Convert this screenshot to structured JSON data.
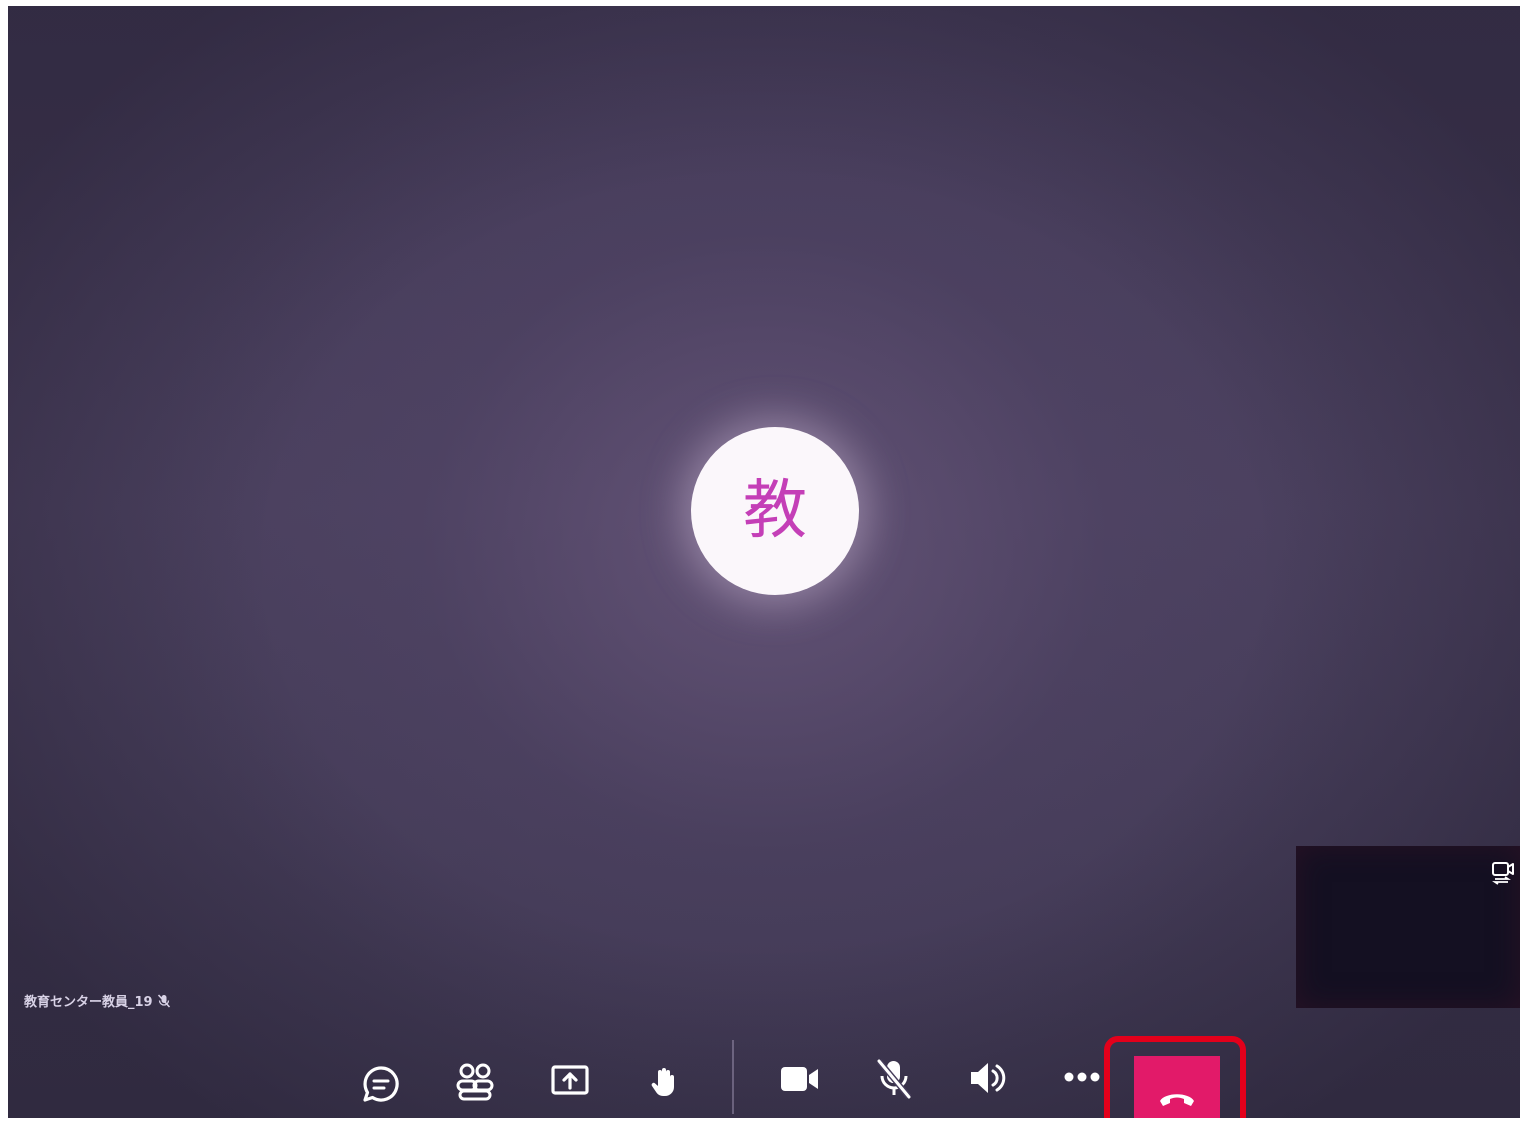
{
  "stage": {
    "avatar_initial": "教",
    "participant_name": "教育センター教員_19"
  },
  "self_view": {
    "icon": "switch-camera-icon"
  },
  "toolbar": {
    "buttons": [
      {
        "id": "chat",
        "icon": "chat-icon"
      },
      {
        "id": "participants",
        "icon": "participants-icon"
      },
      {
        "id": "share",
        "icon": "share-screen-icon"
      },
      {
        "id": "raise_hand",
        "icon": "raise-hand-icon"
      },
      {
        "id": "camera",
        "icon": "video-camera-icon"
      },
      {
        "id": "mic",
        "icon": "mic-muted-icon"
      },
      {
        "id": "speaker",
        "icon": "speaker-icon"
      },
      {
        "id": "more",
        "icon": "more-icon"
      },
      {
        "id": "hangup",
        "icon": "hang-up-icon"
      }
    ]
  },
  "colors": {
    "background": "#463d5b",
    "avatar_bg": "#fbf7fb",
    "avatar_text": "#c43fb7",
    "hangup": "#e21a69",
    "highlight": "#e3001b",
    "icon": "#ffffff"
  }
}
